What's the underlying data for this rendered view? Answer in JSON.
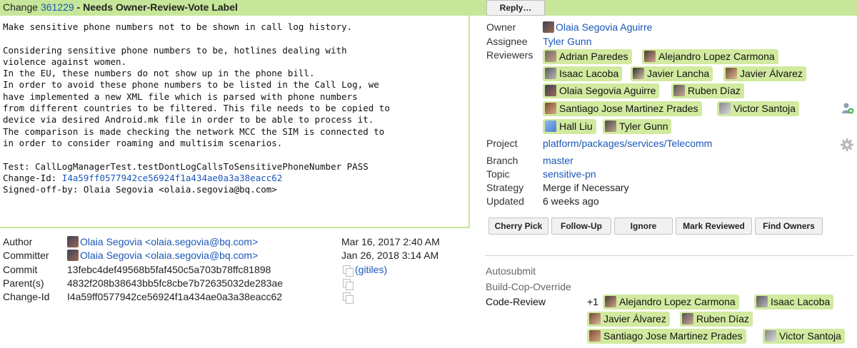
{
  "header": {
    "change_prefix": "Change",
    "change_number": "361229",
    "separator": " - ",
    "status": "Needs Owner-Review-Vote Label",
    "reply_label": "Reply…"
  },
  "commit_message": {
    "body": "Make sensitive phone numbers not to be shown in call log history.\n\nConsidering sensitive phone numbers to be, hotlines dealing with\nviolence against women.\nIn the EU, these numbers do not show up in the phone bill.\nIn order to avoid these phone numbers to be listed in the Call Log, we\nhave implemented a new XML file which is parsed with phone numbers\nfrom different countries to be filtered. This file needs to be copied to\ndevice via desired Android.mk file in order to be able to process it.\nThe comparison is made checking the network MCC the SIM is connected to\nin order to consider roaming and multisim scenarios.\n\nTest: CallLogManagerTest.testDontLogCallsToSensitivePhoneNumber PASS\n",
    "change_id_label": "Change-Id: ",
    "change_id": "I4a59ff0577942ce56924f1a434ae0a3a38eacc62",
    "signed_off": "Signed-off-by: Olaia Segovia <olaia.segovia@bq.com>"
  },
  "info": {
    "author_label": "Author",
    "author": "Olaia Segovia <olaia.segovia@bq.com>",
    "author_date": "Mar 16, 2017 2:40 AM",
    "committer_label": "Committer",
    "committer": "Olaia Segovia <olaia.segovia@bq.com>",
    "committer_date": "Jan 26, 2018 3:14 AM",
    "commit_label": "Commit",
    "commit": "13febc4def49568b5faf450c5a703b78ffc81898",
    "gitiles": "(gitiles)",
    "parents_label": "Parent(s)",
    "parents": "4832f208b38643bb5fc8cbe7b72635032de283ae",
    "changeid_label": "Change-Id",
    "changeid": "I4a59ff0577942ce56924f1a434ae0a3a38eacc62"
  },
  "details": {
    "owner_label": "Owner",
    "owner": "Olaia Segovia Aguirre",
    "assignee_label": "Assignee",
    "assignee": "Tyler Gunn",
    "reviewers_label": "Reviewers",
    "reviewers": [
      "Adrian Paredes",
      "Alejandro Lopez Carmona",
      "Isaac Lacoba",
      "Javier Lancha",
      "Javier Álvarez",
      "Olaia Segovia Aguirre",
      "Ruben Díaz",
      "Santiago Jose Martinez Prades",
      "Victor Santoja",
      "Hall Liu",
      "Tyler Gunn"
    ],
    "project_label": "Project",
    "project": "platform/packages/services/Telecomm",
    "branch_label": "Branch",
    "branch": "master",
    "topic_label": "Topic",
    "topic": "sensitive-pn",
    "strategy_label": "Strategy",
    "strategy": "Merge if Necessary",
    "updated_label": "Updated",
    "updated": "6 weeks ago"
  },
  "actions": {
    "cherry_pick": "Cherry Pick",
    "follow_up": "Follow-Up",
    "ignore": "Ignore",
    "mark_reviewed": "Mark Reviewed",
    "find_owners": "Find Owners"
  },
  "labels": {
    "autosubmit": "Autosubmit",
    "build_cop": "Build-Cop-Override",
    "code_review": "Code-Review",
    "code_review_vote": "+1",
    "code_review_voters": [
      "Alejandro Lopez Carmona",
      "Isaac Lacoba",
      "Javier Álvarez",
      "Ruben Díaz",
      "Santiago Jose Martinez Prades",
      "Victor Santoja"
    ]
  },
  "colors": {
    "accent_green": "#c6e79a",
    "chip_green": "#d1ea9f",
    "link_blue": "#1a57b8"
  }
}
